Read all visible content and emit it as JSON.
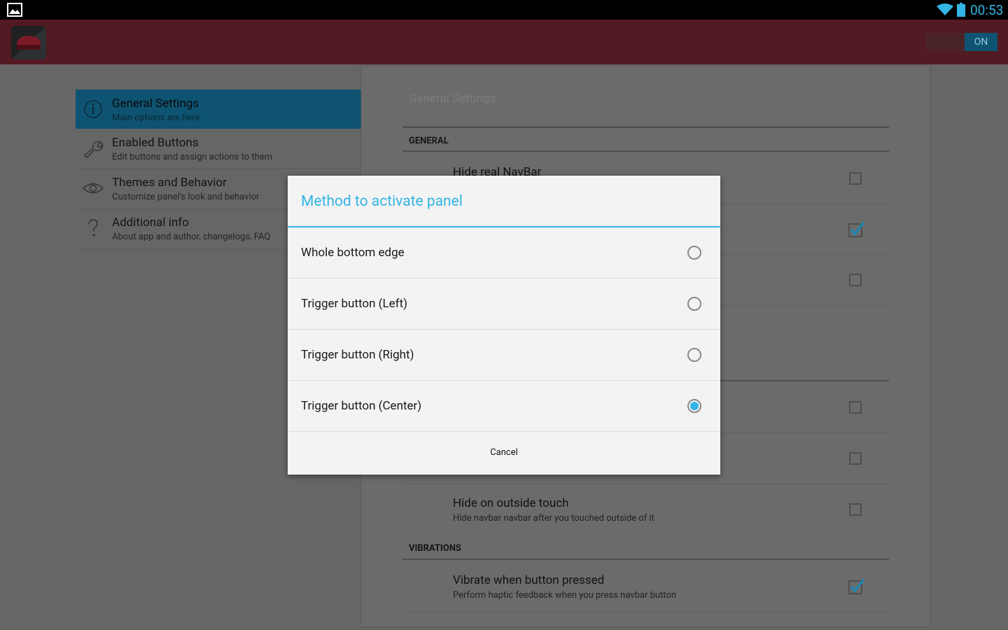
{
  "status_bar": {
    "time": "00:53"
  },
  "app_bar": {
    "toggle_label": "ON"
  },
  "nav": {
    "items": [
      {
        "title": "General Settings",
        "subtitle": "Main options are here",
        "icon": "info-icon"
      },
      {
        "title": "Enabled Buttons",
        "subtitle": "Edit buttons and assign actions to them",
        "icon": "wrench-icon"
      },
      {
        "title": "Themes and Behavior",
        "subtitle": "Customize panel's look and behavior",
        "icon": "eye-icon"
      },
      {
        "title": "Additional info",
        "subtitle": "About app and author, changelogs, FAQ",
        "icon": "question-icon"
      }
    ]
  },
  "panel": {
    "title": "General Settings",
    "section_general": "GENERAL",
    "row_hide_navbar": "Hide real NavBar",
    "row_outside_title": "Hide on outside touch",
    "row_outside_sub": "Hide navbar navbar after you touched outside of it",
    "section_vibrations": "VIBRATIONS",
    "row_vibrate_title": "Vibrate when button pressed",
    "row_vibrate_sub": "Perform haptic feedback when you press navbar button"
  },
  "dialog": {
    "title": "Method to activate panel",
    "options": [
      {
        "label": "Whole bottom edge",
        "selected": false
      },
      {
        "label": "Trigger button (Left)",
        "selected": false
      },
      {
        "label": "Trigger button (Right)",
        "selected": false
      },
      {
        "label": "Trigger button (Center)",
        "selected": true
      }
    ],
    "cancel_label": "Cancel"
  },
  "colors": {
    "accent": "#33b5e5",
    "app_bar": "#521a22",
    "status_bar": "#000000",
    "dim_background": "#666666",
    "dialog_background": "#f3f3f3"
  }
}
